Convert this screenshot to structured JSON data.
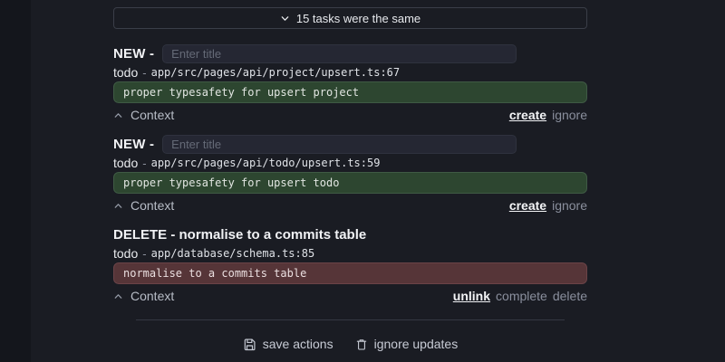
{
  "collapse_bar": {
    "label": "15 tasks were the same"
  },
  "tasks": [
    {
      "kind_label": "NEW -",
      "title_placeholder": "Enter title",
      "type_label": "todo",
      "separator": "-",
      "file_path": "app/src/pages/api/project/upsert.ts:67",
      "code": "proper typesafety for upsert project",
      "context_label": "Context",
      "actions": [
        {
          "label": "create"
        },
        {
          "label": "ignore"
        }
      ]
    },
    {
      "kind_label": "NEW -",
      "title_placeholder": "Enter title",
      "type_label": "todo",
      "separator": "-",
      "file_path": "app/src/pages/api/todo/upsert.ts:59",
      "code": "proper typesafety for upsert todo",
      "context_label": "Context",
      "actions": [
        {
          "label": "create"
        },
        {
          "label": "ignore"
        }
      ]
    },
    {
      "title": "DELETE - normalise to a commits table",
      "type_label": "todo",
      "separator": "-",
      "file_path": "app/database/schema.ts:85",
      "code": "normalise to a commits table",
      "context_label": "Context",
      "actions": [
        {
          "label": "unlink"
        },
        {
          "label": "complete"
        },
        {
          "label": "delete"
        }
      ]
    }
  ],
  "footer": {
    "save_label": "save actions",
    "ignore_label": "ignore updates"
  },
  "icons": {
    "collapse_bar": "chevron-down",
    "context": "chevron-up",
    "save": "floppy-disk",
    "ignore": "trash-can"
  },
  "colors": {
    "background": "#1a1c23",
    "green_box_bg": "#2d4630",
    "green_box_border": "#3f5a44",
    "red_box_bg": "#563538",
    "red_box_border": "#6a4347",
    "primary_link": "#f3f4f6",
    "secondary_link": "#8a8f9d"
  }
}
